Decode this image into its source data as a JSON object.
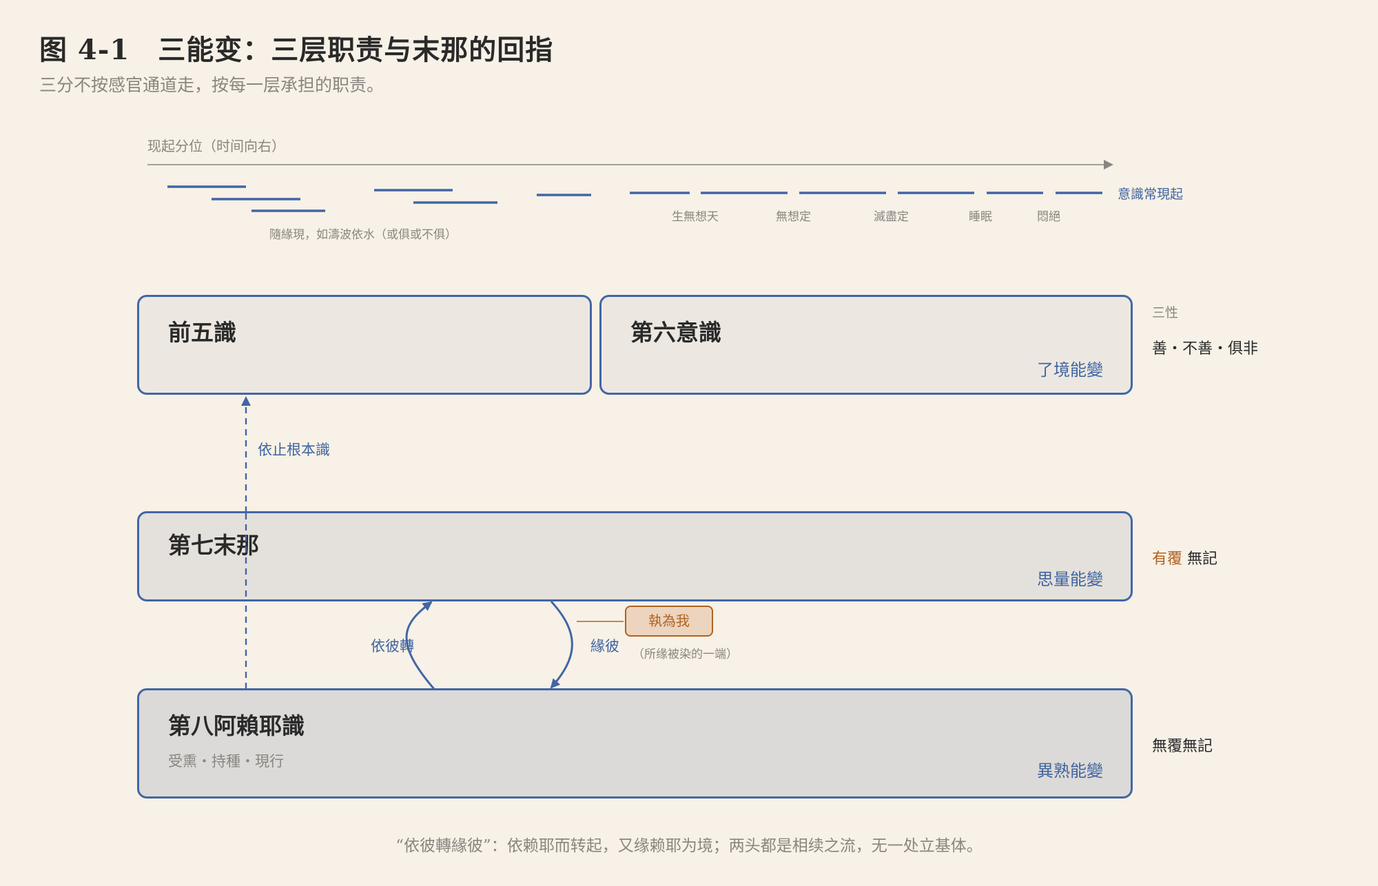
{
  "header": {
    "title": "图 4-1　三能变：三层职责与末那的回指",
    "subtitle": "三分不按感官通道走，按每一层承担的职责。"
  },
  "timeline": {
    "axis_label": "现起分位（时间向右）",
    "five_note": "隨緣現，如濤波依水（或俱或不俱）",
    "sixth_label": "意識常現起",
    "gaps": [
      "生無想天",
      "無想定",
      "滅盡定",
      "睡眠",
      "悶絕"
    ]
  },
  "layers": {
    "five": {
      "name": "前五識"
    },
    "six": {
      "name": "第六意識",
      "function": "了境能變"
    },
    "seven": {
      "name": "第七末那",
      "function": "思量能變"
    },
    "eight": {
      "name": "第八阿賴耶識",
      "function": "異熟能變",
      "sub": "受熏・持種・現行"
    }
  },
  "natures": {
    "heading": "三性",
    "six": "善・不善・俱非",
    "seven_accent": "有覆",
    "seven_rest": " 無記",
    "eight": "無覆無記"
  },
  "relations": {
    "rely_root": "依止根本識",
    "rely_that": "依彼轉",
    "cognize_that": "緣彼",
    "grasp_self": "執為我",
    "grasp_note": "（所缘被染的一端）"
  },
  "caption": "“依彼轉緣彼”：依赖耶而转起，又缘赖耶为境；两头都是相续之流，无一处立基体。",
  "colors": {
    "background": "#f7f1e7",
    "blue": "#4266a6",
    "orange": "#b1621e",
    "gray_text": "#8a8580",
    "box_five_six": "#ece8e1",
    "box_seven": "#e4e1dc",
    "box_eight": "#dbdad8"
  }
}
